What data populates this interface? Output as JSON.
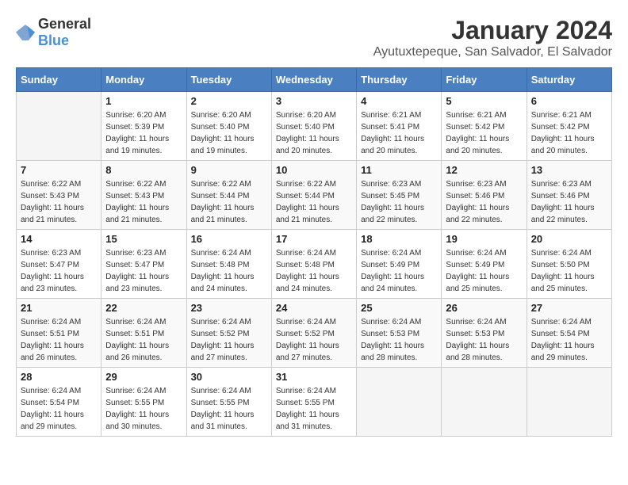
{
  "logo": {
    "general": "General",
    "blue": "Blue"
  },
  "title": "January 2024",
  "location": "Ayutuxtepeque, San Salvador, El Salvador",
  "headers": [
    "Sunday",
    "Monday",
    "Tuesday",
    "Wednesday",
    "Thursday",
    "Friday",
    "Saturday"
  ],
  "weeks": [
    [
      {
        "day": "",
        "sunrise": "",
        "sunset": "",
        "daylight": ""
      },
      {
        "day": "1",
        "sunrise": "Sunrise: 6:20 AM",
        "sunset": "Sunset: 5:39 PM",
        "daylight": "Daylight: 11 hours and 19 minutes."
      },
      {
        "day": "2",
        "sunrise": "Sunrise: 6:20 AM",
        "sunset": "Sunset: 5:40 PM",
        "daylight": "Daylight: 11 hours and 19 minutes."
      },
      {
        "day": "3",
        "sunrise": "Sunrise: 6:20 AM",
        "sunset": "Sunset: 5:40 PM",
        "daylight": "Daylight: 11 hours and 20 minutes."
      },
      {
        "day": "4",
        "sunrise": "Sunrise: 6:21 AM",
        "sunset": "Sunset: 5:41 PM",
        "daylight": "Daylight: 11 hours and 20 minutes."
      },
      {
        "day": "5",
        "sunrise": "Sunrise: 6:21 AM",
        "sunset": "Sunset: 5:42 PM",
        "daylight": "Daylight: 11 hours and 20 minutes."
      },
      {
        "day": "6",
        "sunrise": "Sunrise: 6:21 AM",
        "sunset": "Sunset: 5:42 PM",
        "daylight": "Daylight: 11 hours and 20 minutes."
      }
    ],
    [
      {
        "day": "7",
        "sunrise": "Sunrise: 6:22 AM",
        "sunset": "Sunset: 5:43 PM",
        "daylight": "Daylight: 11 hours and 21 minutes."
      },
      {
        "day": "8",
        "sunrise": "Sunrise: 6:22 AM",
        "sunset": "Sunset: 5:43 PM",
        "daylight": "Daylight: 11 hours and 21 minutes."
      },
      {
        "day": "9",
        "sunrise": "Sunrise: 6:22 AM",
        "sunset": "Sunset: 5:44 PM",
        "daylight": "Daylight: 11 hours and 21 minutes."
      },
      {
        "day": "10",
        "sunrise": "Sunrise: 6:22 AM",
        "sunset": "Sunset: 5:44 PM",
        "daylight": "Daylight: 11 hours and 21 minutes."
      },
      {
        "day": "11",
        "sunrise": "Sunrise: 6:23 AM",
        "sunset": "Sunset: 5:45 PM",
        "daylight": "Daylight: 11 hours and 22 minutes."
      },
      {
        "day": "12",
        "sunrise": "Sunrise: 6:23 AM",
        "sunset": "Sunset: 5:46 PM",
        "daylight": "Daylight: 11 hours and 22 minutes."
      },
      {
        "day": "13",
        "sunrise": "Sunrise: 6:23 AM",
        "sunset": "Sunset: 5:46 PM",
        "daylight": "Daylight: 11 hours and 22 minutes."
      }
    ],
    [
      {
        "day": "14",
        "sunrise": "Sunrise: 6:23 AM",
        "sunset": "Sunset: 5:47 PM",
        "daylight": "Daylight: 11 hours and 23 minutes."
      },
      {
        "day": "15",
        "sunrise": "Sunrise: 6:23 AM",
        "sunset": "Sunset: 5:47 PM",
        "daylight": "Daylight: 11 hours and 23 minutes."
      },
      {
        "day": "16",
        "sunrise": "Sunrise: 6:24 AM",
        "sunset": "Sunset: 5:48 PM",
        "daylight": "Daylight: 11 hours and 24 minutes."
      },
      {
        "day": "17",
        "sunrise": "Sunrise: 6:24 AM",
        "sunset": "Sunset: 5:48 PM",
        "daylight": "Daylight: 11 hours and 24 minutes."
      },
      {
        "day": "18",
        "sunrise": "Sunrise: 6:24 AM",
        "sunset": "Sunset: 5:49 PM",
        "daylight": "Daylight: 11 hours and 24 minutes."
      },
      {
        "day": "19",
        "sunrise": "Sunrise: 6:24 AM",
        "sunset": "Sunset: 5:49 PM",
        "daylight": "Daylight: 11 hours and 25 minutes."
      },
      {
        "day": "20",
        "sunrise": "Sunrise: 6:24 AM",
        "sunset": "Sunset: 5:50 PM",
        "daylight": "Daylight: 11 hours and 25 minutes."
      }
    ],
    [
      {
        "day": "21",
        "sunrise": "Sunrise: 6:24 AM",
        "sunset": "Sunset: 5:51 PM",
        "daylight": "Daylight: 11 hours and 26 minutes."
      },
      {
        "day": "22",
        "sunrise": "Sunrise: 6:24 AM",
        "sunset": "Sunset: 5:51 PM",
        "daylight": "Daylight: 11 hours and 26 minutes."
      },
      {
        "day": "23",
        "sunrise": "Sunrise: 6:24 AM",
        "sunset": "Sunset: 5:52 PM",
        "daylight": "Daylight: 11 hours and 27 minutes."
      },
      {
        "day": "24",
        "sunrise": "Sunrise: 6:24 AM",
        "sunset": "Sunset: 5:52 PM",
        "daylight": "Daylight: 11 hours and 27 minutes."
      },
      {
        "day": "25",
        "sunrise": "Sunrise: 6:24 AM",
        "sunset": "Sunset: 5:53 PM",
        "daylight": "Daylight: 11 hours and 28 minutes."
      },
      {
        "day": "26",
        "sunrise": "Sunrise: 6:24 AM",
        "sunset": "Sunset: 5:53 PM",
        "daylight": "Daylight: 11 hours and 28 minutes."
      },
      {
        "day": "27",
        "sunrise": "Sunrise: 6:24 AM",
        "sunset": "Sunset: 5:54 PM",
        "daylight": "Daylight: 11 hours and 29 minutes."
      }
    ],
    [
      {
        "day": "28",
        "sunrise": "Sunrise: 6:24 AM",
        "sunset": "Sunset: 5:54 PM",
        "daylight": "Daylight: 11 hours and 29 minutes."
      },
      {
        "day": "29",
        "sunrise": "Sunrise: 6:24 AM",
        "sunset": "Sunset: 5:55 PM",
        "daylight": "Daylight: 11 hours and 30 minutes."
      },
      {
        "day": "30",
        "sunrise": "Sunrise: 6:24 AM",
        "sunset": "Sunset: 5:55 PM",
        "daylight": "Daylight: 11 hours and 31 minutes."
      },
      {
        "day": "31",
        "sunrise": "Sunrise: 6:24 AM",
        "sunset": "Sunset: 5:55 PM",
        "daylight": "Daylight: 11 hours and 31 minutes."
      },
      {
        "day": "",
        "sunrise": "",
        "sunset": "",
        "daylight": ""
      },
      {
        "day": "",
        "sunrise": "",
        "sunset": "",
        "daylight": ""
      },
      {
        "day": "",
        "sunrise": "",
        "sunset": "",
        "daylight": ""
      }
    ]
  ]
}
